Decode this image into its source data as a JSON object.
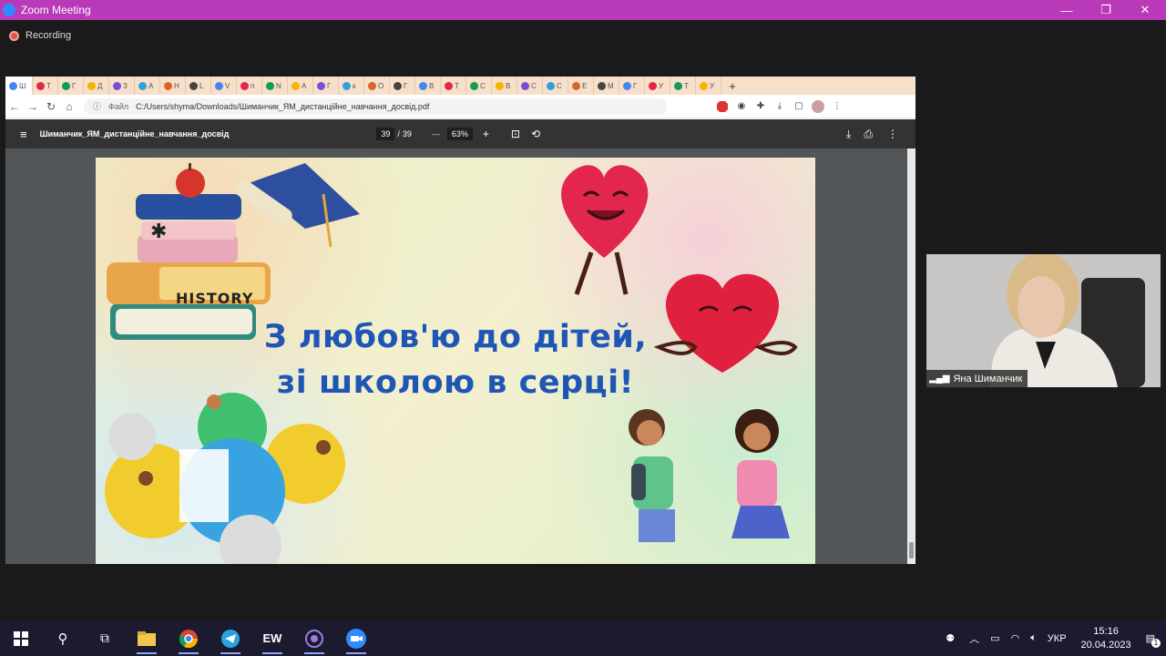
{
  "zoom_window": {
    "title": "Zoom Meeting",
    "minimize": "—",
    "restore": "❐",
    "close": "✕"
  },
  "recording": {
    "label": "Recording"
  },
  "browser": {
    "tabs": [
      "Ш",
      "Т",
      "Г",
      "Д",
      "З",
      "А",
      "Н",
      "L",
      "V",
      "п",
      "N",
      "А",
      "Г",
      "к",
      "О",
      "Г",
      "В",
      "Т",
      "С",
      "В",
      "С",
      "С",
      "Е",
      "М",
      "Г",
      "У",
      "Т",
      "У"
    ],
    "address": {
      "prefix": "Файл",
      "url": "C:/Users/shyma/Downloads/Шиманчик_ЯМ_дистанційне_навчання_досвід.pdf"
    },
    "new_tab": "+"
  },
  "pdf": {
    "filename": "Шиманчик_ЯМ_дистанційне_навчання_досвід",
    "page_current": "39",
    "page_sep": "/",
    "page_total": "39",
    "zoom": "63%",
    "minus": "—",
    "plus": "+"
  },
  "slide": {
    "history_label": "HISTORY",
    "title_line1": "З любов'ю до дітей,",
    "title_line2": "зі школою в серці!"
  },
  "webcam": {
    "participant_name": "Яна Шиманчик"
  },
  "taskbar": {
    "apps": [
      "start-icon",
      "search-icon",
      "task-view-icon",
      "file-explorer-icon",
      "chrome-icon",
      "telegram-icon",
      "word-icon",
      "viber-icon",
      "zoom-icon"
    ],
    "lang": "УКР",
    "time": "15:16",
    "date": "20.04.2023",
    "notifications": "1"
  },
  "colors": {
    "zoom_titlebar": "#b83ab8",
    "slide_title": "#1f56b5",
    "taskbar": "#1b1a2f"
  }
}
